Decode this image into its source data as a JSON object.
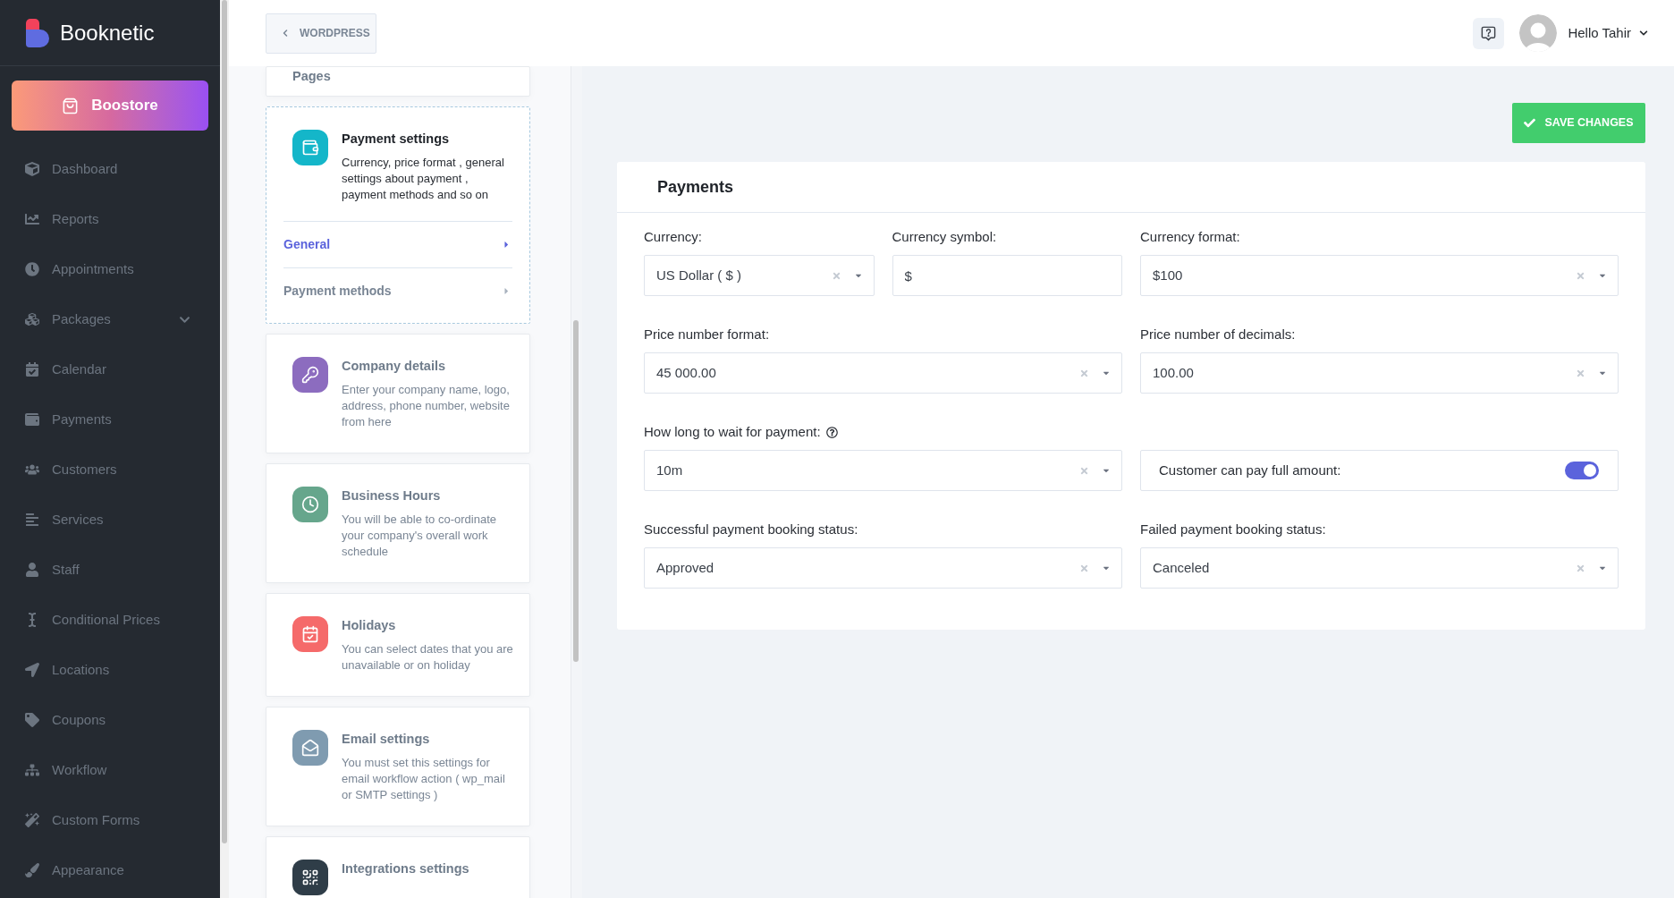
{
  "sidebar": {
    "logo": "Booknetic",
    "promo_button": "Boostore",
    "items": [
      {
        "label": "Dashboard",
        "selected": false,
        "expandable": false
      },
      {
        "label": "Reports",
        "selected": false,
        "expandable": false
      },
      {
        "label": "Appointments",
        "selected": false,
        "expandable": false
      },
      {
        "label": "Packages",
        "selected": false,
        "expandable": true
      },
      {
        "label": "Calendar",
        "selected": false,
        "expandable": false
      },
      {
        "label": "Payments",
        "selected": false,
        "expandable": false
      },
      {
        "label": "Customers",
        "selected": false,
        "expandable": false
      },
      {
        "label": "Services",
        "selected": false,
        "expandable": false
      },
      {
        "label": "Staff",
        "selected": false,
        "expandable": false
      },
      {
        "label": "Conditional Prices",
        "selected": false,
        "expandable": false
      },
      {
        "label": "Locations",
        "selected": false,
        "expandable": false
      },
      {
        "label": "Coupons",
        "selected": false,
        "expandable": false
      },
      {
        "label": "Workflow",
        "selected": false,
        "expandable": false
      },
      {
        "label": "Custom Forms",
        "selected": false,
        "expandable": false
      },
      {
        "label": "Appearance",
        "selected": false,
        "expandable": false
      }
    ]
  },
  "top_bar": {
    "back_button": "WORDPRESS",
    "greeting": "Hello Tahir"
  },
  "settings_menu": {
    "cards": [
      {
        "title": "Pages",
        "selected": false
      },
      {
        "title": "Payment settings",
        "description": "Currency, price format , general settings about payment , payment methods and so on",
        "color": "#14b6c9",
        "selected": true,
        "subitems": [
          {
            "label": "General",
            "selected": true
          },
          {
            "label": "Payment methods",
            "selected": false
          }
        ]
      },
      {
        "title": "Company details",
        "description": "Enter your company name, logo, address, phone number, website from here",
        "color": "#8c6cbf",
        "selected": false
      },
      {
        "title": "Business Hours",
        "description": "You will be able to co-ordinate your company's overall work schedule",
        "color": "#66a68c",
        "selected": false
      },
      {
        "title": "Holidays",
        "description": "You can select dates that you are unavailable or on holiday",
        "color": "#f56a6a",
        "selected": false
      },
      {
        "title": "Email settings",
        "description": "You must set this settings for email workflow action ( wp_mail or SMTP settings )",
        "color": "#7f9bb0",
        "selected": false
      },
      {
        "title": "Integrations settings",
        "color": "#2f3d48",
        "selected": false
      }
    ]
  },
  "payments": {
    "save_button": "SAVE CHANGES",
    "title": "Payments",
    "rows": [
      [
        {
          "kind": "select",
          "label": "Currency:",
          "value": "US Dollar ( $ )"
        },
        {
          "kind": "text",
          "label": "Currency symbol:",
          "value": "$"
        },
        {
          "kind": "select",
          "label": "Currency format:",
          "value": "$100"
        }
      ],
      [
        {
          "kind": "select",
          "label": "Price number format:",
          "value": "45 000.00"
        },
        {
          "kind": "select",
          "label": "Price number of decimals:",
          "value": "100.00"
        }
      ],
      [
        {
          "kind": "select",
          "label": "How long to wait for payment:",
          "value": "10m",
          "help": true
        },
        {
          "kind": "toggle",
          "label": "Customer can pay full amount:",
          "on": true
        }
      ],
      [
        {
          "kind": "select",
          "label": "Successful payment booking status:",
          "value": "Approved"
        },
        {
          "kind": "select",
          "label": "Failed payment booking status:",
          "value": "Canceled"
        }
      ]
    ]
  }
}
